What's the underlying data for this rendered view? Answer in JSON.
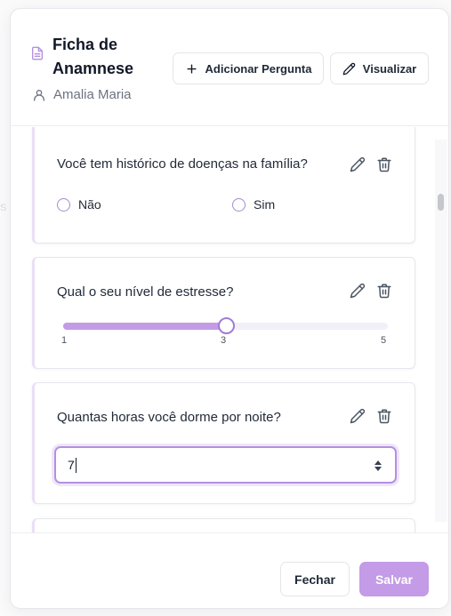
{
  "header": {
    "title": "Ficha de Anamnese",
    "patient_name": "Amalia Maria",
    "add_button_label": "Adicionar Pergunta",
    "preview_button_label": "Visualizar"
  },
  "questions": [
    {
      "text": "Você tem histórico de doenças na família?",
      "type": "radio",
      "options": [
        "Não",
        "Sim"
      ]
    },
    {
      "text": "Qual o seu nível de estresse?",
      "type": "slider",
      "min_label": "1",
      "mid_label": "3",
      "max_label": "5",
      "value_fraction": 0.5
    },
    {
      "text": "Quantas horas você dorme por noite?",
      "type": "number",
      "value": "7"
    }
  ],
  "footer": {
    "close_label": "Fechar",
    "save_label": "Salvar"
  },
  "colors": {
    "accent": "#c39be6",
    "accent_border": "#a07cd4"
  },
  "icons": [
    "document-icon",
    "user-icon",
    "plus-icon",
    "pencil-icon",
    "edit-icon",
    "trash-icon",
    "spinner-arrows-icon"
  ]
}
